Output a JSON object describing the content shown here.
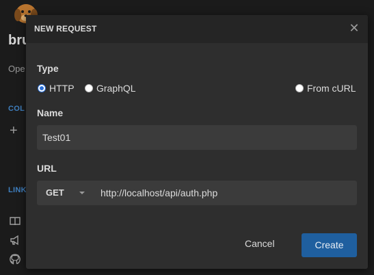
{
  "background": {
    "title": "bru",
    "subtitle": "Ope",
    "collections_label": "COL",
    "add_symbol": "+",
    "links_label": "LINK"
  },
  "dialog": {
    "title": "NEW REQUEST",
    "close_symbol": "✕",
    "type_label": "Type",
    "type_options": [
      "HTTP",
      "GraphQL",
      "From cURL"
    ],
    "selected_type": "HTTP",
    "name_label": "Name",
    "name_value": "Test01",
    "url_label": "URL",
    "method": "GET",
    "url_value": "http://localhost/api/auth.php",
    "cancel_label": "Cancel",
    "create_label": "Create"
  },
  "colors": {
    "accent": "#1f5f9f",
    "radio_selected": "#2a70d8",
    "section_label": "#3f7fbf"
  },
  "icons": [
    "book-icon",
    "megaphone-icon",
    "github-icon",
    "close-icon",
    "chevron-down-icon"
  ]
}
